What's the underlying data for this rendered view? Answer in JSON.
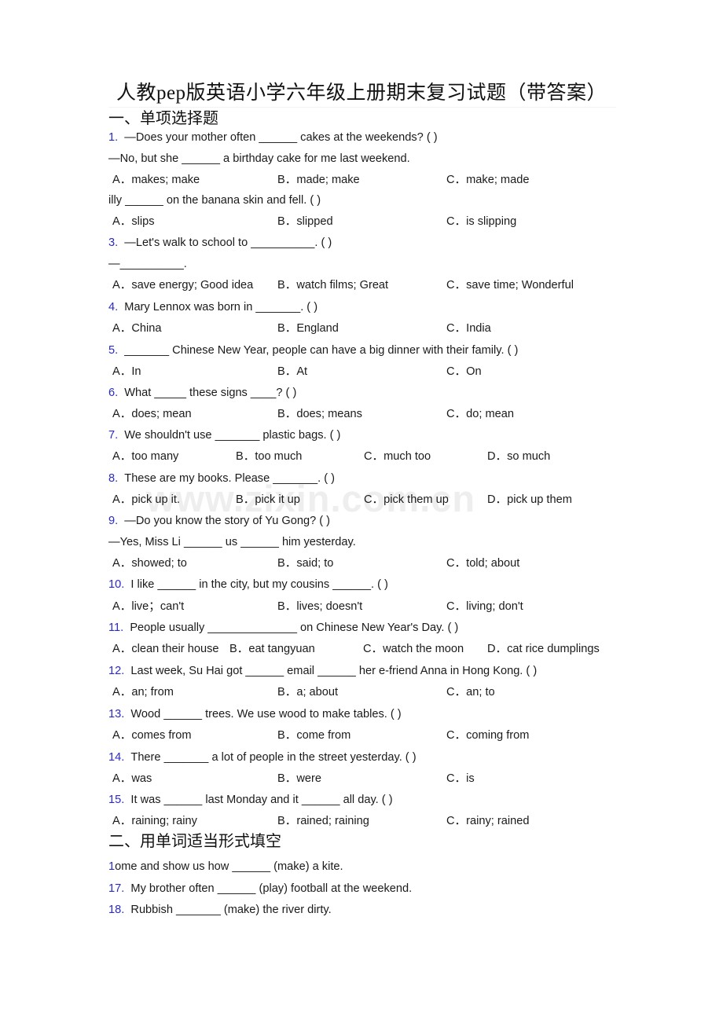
{
  "document": {
    "title": "人教pep版英语小学六年级上册期末复习试题（带答案）",
    "watermark": "www.zixin.com.cn",
    "accent_color": "#2a2ac8",
    "text_color": "#1a1a1a",
    "background_color": "#ffffff"
  },
  "sections": [
    {
      "heading": "一、单项选择题"
    },
    {
      "heading": "二、用单词适当形式填空"
    }
  ],
  "questions": [
    {
      "number": "1.",
      "stem": "—Does your mother often ______ cakes at the weekends? (   )",
      "stem2": "—No, but she ______ a birthday cake for me last weekend.",
      "options": [
        "A．makes; make",
        "B．made; make",
        "C．make; made"
      ]
    },
    {
      "number": "",
      "stem": "illy ______ on the banana skin and fell. (   )",
      "options": [
        "A．slips",
        "B．slipped",
        "C．is slipping"
      ]
    },
    {
      "number": "3.",
      "stem": "—Let's walk to school to __________. (   )",
      "stem2": "—__________.",
      "options": [
        "A．save energy; Good idea",
        "B．watch films; Great",
        "C．save time; Wonderful"
      ]
    },
    {
      "number": "4.",
      "stem": "Mary Lennox was born in _______. (   )",
      "options": [
        "A．China",
        "B．England",
        "C．India"
      ]
    },
    {
      "number": "5.",
      "stem": "_______ Chinese New Year, people can have a big dinner with their family. (   )",
      "options": [
        "A．In",
        "B．At",
        "C．On"
      ]
    },
    {
      "number": "6.",
      "stem": "What _____ these signs ____? (   )",
      "options": [
        "A．does; mean",
        "B．does; means",
        "C．do; mean"
      ]
    },
    {
      "number": "7.",
      "stem": "We shouldn't use _______ plastic bags. (   )",
      "options": [
        "A．too many",
        "B．too much",
        "C．much too",
        "D．so much"
      ]
    },
    {
      "number": "8.",
      "stem": "These are my books. Please _______. (   )",
      "options": [
        "A．pick up it.",
        "B．pick it up",
        "C．pick them up",
        "D．pick up them"
      ]
    },
    {
      "number": "9.",
      "stem": "—Do you know the story of Yu Gong? (   )",
      "stem2": "—Yes, Miss Li ______ us ______ him yesterday.",
      "options": [
        "A．showed; to",
        "B．said; to",
        "C．told; about"
      ]
    },
    {
      "number": "10.",
      "stem": "I like ______ in the city, but my cousins ______. (   )",
      "options": [
        "A．live；can't",
        "B．lives; doesn't",
        "C．living; don't"
      ]
    },
    {
      "number": "11.",
      "stem": "People usually ______________ on Chinese New Year's Day. (   )",
      "options": [
        "A．clean their house",
        "B．eat tangyuan",
        "C．watch the moon",
        "D．cat rice dumplings"
      ]
    },
    {
      "number": "12.",
      "stem": "Last week, Su Hai got ______ email ______ her e-friend Anna in Hong Kong. (   )",
      "options": [
        "A．an; from",
        "B．a; about",
        "C．an; to"
      ]
    },
    {
      "number": "13.",
      "stem": "Wood ______ trees. We use wood to make tables. (   )",
      "options": [
        "A．comes from",
        "B．come from",
        "C．coming from"
      ]
    },
    {
      "number": "14.",
      "stem": "There _______ a lot of people in the street yesterday. (   )",
      "options": [
        "A．was",
        "B．were",
        "C．is"
      ]
    },
    {
      "number": "15.",
      "stem": "It was ______ last Monday and it ______ all day. (   )",
      "options": [
        "A．raining; rainy",
        "B．rained; raining",
        "C．rainy; rained"
      ]
    }
  ],
  "fill_in_questions": [
    {
      "number": "1",
      "text": "ome and show us how ______ (make) a kite."
    },
    {
      "number": "17.",
      "text": "My brother often ______ (play) football at the weekend."
    },
    {
      "number": "18.",
      "text": "Rubbish _______ (make) the river dirty."
    }
  ]
}
